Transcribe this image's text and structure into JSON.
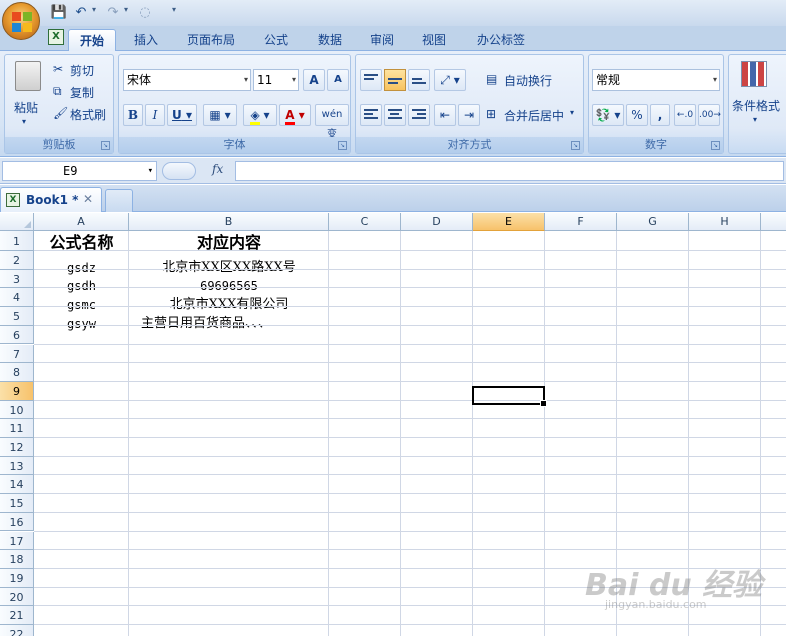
{
  "tabs": [
    "开始",
    "插入",
    "页面布局",
    "公式",
    "数据",
    "审阅",
    "视图",
    "办公标签"
  ],
  "active_tab": "开始",
  "clipboard": {
    "paste": "粘贴",
    "cut": "剪切",
    "copy": "复制",
    "format_painter": "格式刷",
    "group": "剪贴板"
  },
  "font": {
    "name": "宋体",
    "size": "11",
    "grow": "A",
    "shrink": "A",
    "bold": "B",
    "italic": "I",
    "underline": "U",
    "font_color": "A",
    "phonetic": "wén 变",
    "group": "字体"
  },
  "alignment": {
    "wrap_text": "自动换行",
    "merge_center": "合并后居中",
    "group": "对齐方式"
  },
  "number": {
    "format": "常规",
    "percent": "%",
    "comma": ",",
    "group": "数字"
  },
  "styles": {
    "conditional_format": "条件格式"
  },
  "formula_bar": {
    "name_box": "E9",
    "fx": "fx",
    "value": ""
  },
  "workbook_tab": {
    "name": "Book1 *",
    "close": "✕"
  },
  "columns": [
    "A",
    "B",
    "C",
    "D",
    "E",
    "F",
    "G",
    "H"
  ],
  "selected_column": "E",
  "rows": [
    "1",
    "2",
    "3",
    "4",
    "5",
    "6",
    "7",
    "8",
    "9",
    "10",
    "11",
    "12",
    "13",
    "14",
    "15",
    "16",
    "17",
    "18",
    "19",
    "20",
    "21",
    "22"
  ],
  "selected_row": "9",
  "sheet": {
    "header": [
      "公式名称",
      "对应内容"
    ],
    "data": [
      [
        "gsdz",
        "北京市XX区XX路XX号"
      ],
      [
        "gsdh",
        "69696565"
      ],
      [
        "gsmc",
        "北京市XXX有限公司"
      ],
      [
        "gsyw",
        "主营日用百货商品、、、"
      ]
    ]
  },
  "watermark": {
    "brand": "Bai du 经验",
    "url": "jingyan.baidu.com"
  },
  "colors": {
    "accent": "#15428b",
    "ribbon": "#dfe9f7",
    "selection": "#f7c26b"
  }
}
